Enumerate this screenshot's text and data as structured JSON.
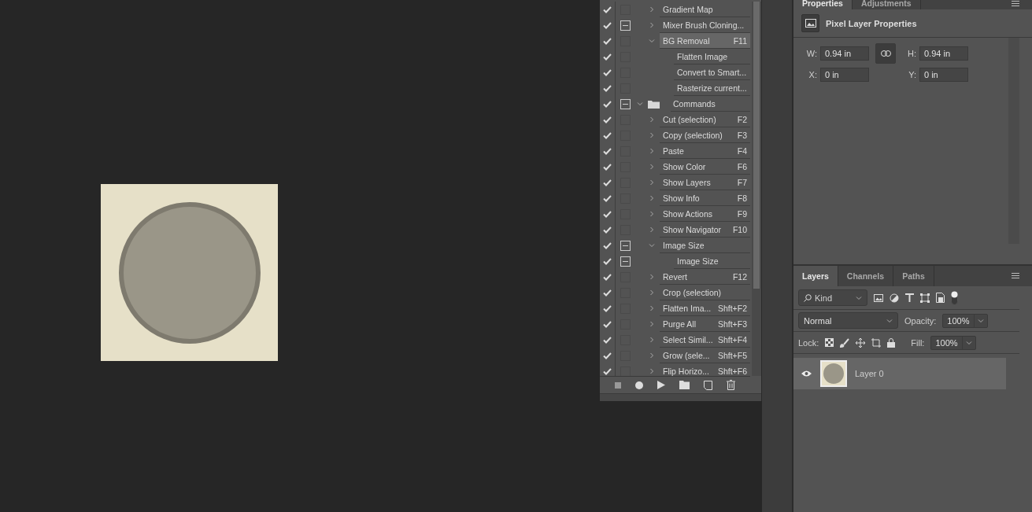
{
  "canvas": {
    "photo": true
  },
  "actions_panel": {
    "items": [
      {
        "kind": "action",
        "name": "Gradient Map",
        "enabled": true,
        "dialog": false,
        "expanded": false,
        "selected": false
      },
      {
        "kind": "action",
        "name": "Mixer Brush Cloning...",
        "enabled": true,
        "dialog": true,
        "expanded": false,
        "selected": false
      },
      {
        "kind": "action",
        "name": "BG Removal",
        "shortcut": "F11",
        "enabled": true,
        "dialog": false,
        "expanded": true,
        "selected": true,
        "children": [
          {
            "kind": "step",
            "name": "Flatten Image",
            "enabled": true,
            "dialog": false,
            "selected": false
          },
          {
            "kind": "step",
            "name": "Convert to Smart...",
            "enabled": true,
            "dialog": false,
            "selected": false
          },
          {
            "kind": "step",
            "name": "Rasterize current...",
            "enabled": true,
            "dialog": false,
            "selected": false
          }
        ]
      },
      {
        "kind": "set",
        "name": "Commands",
        "enabled": true,
        "dialog": true,
        "expanded": true,
        "selected": false,
        "children": [
          {
            "kind": "action",
            "name": "Cut (selection)",
            "shortcut": "F2",
            "enabled": true,
            "dialog": false,
            "expanded": false,
            "selected": false
          },
          {
            "kind": "action",
            "name": "Copy (selection)",
            "shortcut": "F3",
            "enabled": true,
            "dialog": false,
            "expanded": false,
            "selected": false
          },
          {
            "kind": "action",
            "name": "Paste",
            "shortcut": "F4",
            "enabled": true,
            "dialog": false,
            "expanded": false,
            "selected": false
          },
          {
            "kind": "action",
            "name": "Show Color",
            "shortcut": "F6",
            "enabled": true,
            "dialog": false,
            "expanded": false,
            "selected": false
          },
          {
            "kind": "action",
            "name": "Show Layers",
            "shortcut": "F7",
            "enabled": true,
            "dialog": false,
            "expanded": false,
            "selected": false
          },
          {
            "kind": "action",
            "name": "Show Info",
            "shortcut": "F8",
            "enabled": true,
            "dialog": false,
            "expanded": false,
            "selected": false
          },
          {
            "kind": "action",
            "name": "Show Actions",
            "shortcut": "F9",
            "enabled": true,
            "dialog": false,
            "expanded": false,
            "selected": false
          },
          {
            "kind": "action",
            "name": "Show Navigator",
            "shortcut": "F10",
            "enabled": true,
            "dialog": false,
            "expanded": false,
            "selected": false
          },
          {
            "kind": "action",
            "name": "Image Size",
            "enabled": true,
            "dialog": true,
            "expanded": true,
            "selected": false,
            "children": [
              {
                "kind": "step",
                "name": "Image Size",
                "enabled": true,
                "dialog": true,
                "selected": false
              }
            ]
          },
          {
            "kind": "action",
            "name": "Revert",
            "shortcut": "F12",
            "enabled": true,
            "dialog": false,
            "expanded": false,
            "selected": false
          },
          {
            "kind": "action",
            "name": "Crop (selection)",
            "enabled": true,
            "dialog": false,
            "expanded": false,
            "selected": false
          },
          {
            "kind": "action",
            "name": "Flatten Ima...",
            "shortcut": "Shft+F2",
            "enabled": true,
            "dialog": false,
            "expanded": false,
            "selected": false
          },
          {
            "kind": "action",
            "name": "Purge All",
            "shortcut": "Shft+F3",
            "enabled": true,
            "dialog": false,
            "expanded": false,
            "selected": false
          },
          {
            "kind": "action",
            "name": "Select Simil...",
            "shortcut": "Shft+F4",
            "enabled": true,
            "dialog": false,
            "expanded": false,
            "selected": false
          },
          {
            "kind": "action",
            "name": "Grow (sele...",
            "shortcut": "Shft+F5",
            "enabled": true,
            "dialog": false,
            "expanded": false,
            "selected": false
          },
          {
            "kind": "action",
            "name": "Flip Horizo...",
            "shortcut": "Shft+F6",
            "enabled": true,
            "dialog": false,
            "expanded": false,
            "selected": false
          }
        ]
      }
    ]
  },
  "properties_panel": {
    "tabs": [
      {
        "label": "Properties",
        "selected": true
      },
      {
        "label": "Adjustments",
        "selected": false
      }
    ],
    "heading": "Pixel Layer Properties",
    "linked": true,
    "fields": [
      {
        "label": "W:",
        "value": "0.94 in"
      },
      {
        "label": "H:",
        "value": "0.94 in"
      },
      {
        "label": "X:",
        "value": "0 in"
      },
      {
        "label": "Y:",
        "value": "0 in"
      }
    ]
  },
  "layers_panel": {
    "tabs": [
      {
        "label": "Layers",
        "selected": true
      },
      {
        "label": "Channels",
        "selected": false
      },
      {
        "label": "Paths",
        "selected": false
      }
    ],
    "filter": "Kind",
    "blend_mode": "Normal",
    "opacity_label": "Opacity:",
    "opacity": "100%",
    "lock_label": "Lock:",
    "fill_label": "Fill:",
    "fill": "100%",
    "layers": [
      {
        "name": "Layer 0",
        "visible": true,
        "selected": true
      }
    ]
  }
}
